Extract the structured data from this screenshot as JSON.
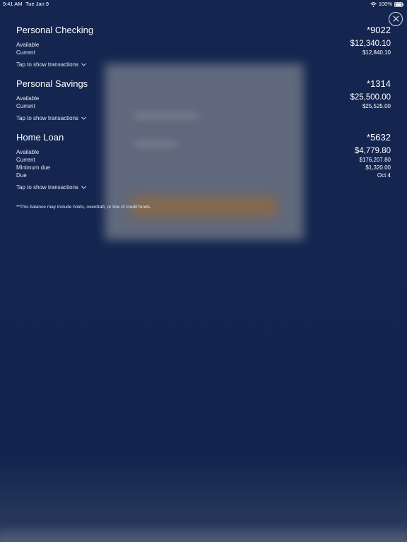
{
  "status_bar": {
    "time": "9:41 AM",
    "date": "Tue Jan 9",
    "battery": "100%"
  },
  "accounts": [
    {
      "name": "Personal Checking",
      "number": "*9022",
      "available_label": "Available",
      "available_value": "$12,340.10",
      "current_label": "Current",
      "current_value": "$12,840.10",
      "toggle_label": "Tap to show transactions"
    },
    {
      "name": "Personal Savings",
      "number": "*1314",
      "available_label": "Available",
      "available_value": "$25,500.00",
      "current_label": "Current",
      "current_value": "$25,525.00",
      "toggle_label": "Tap to show transactions"
    },
    {
      "name": "Home Loan",
      "number": "*5632",
      "available_label": "Available",
      "available_value": "$4,779.80",
      "current_label": "Current",
      "current_value": "$176,207.80",
      "minimum_due_label": "Minimum due",
      "minimum_due_value": "$1,320.00",
      "due_label": "Due",
      "due_value": "Oct 4",
      "toggle_label": "Tap to show transactions"
    }
  ],
  "footnote": "**This balance may include holds, overdraft, or line of credit funds.",
  "icons": {
    "close": "close-icon",
    "chevron": "chevron-down-icon",
    "wifi": "wifi-icon",
    "battery": "battery-icon"
  },
  "colors": {
    "background": "#13254f",
    "text": "#ffffff"
  }
}
